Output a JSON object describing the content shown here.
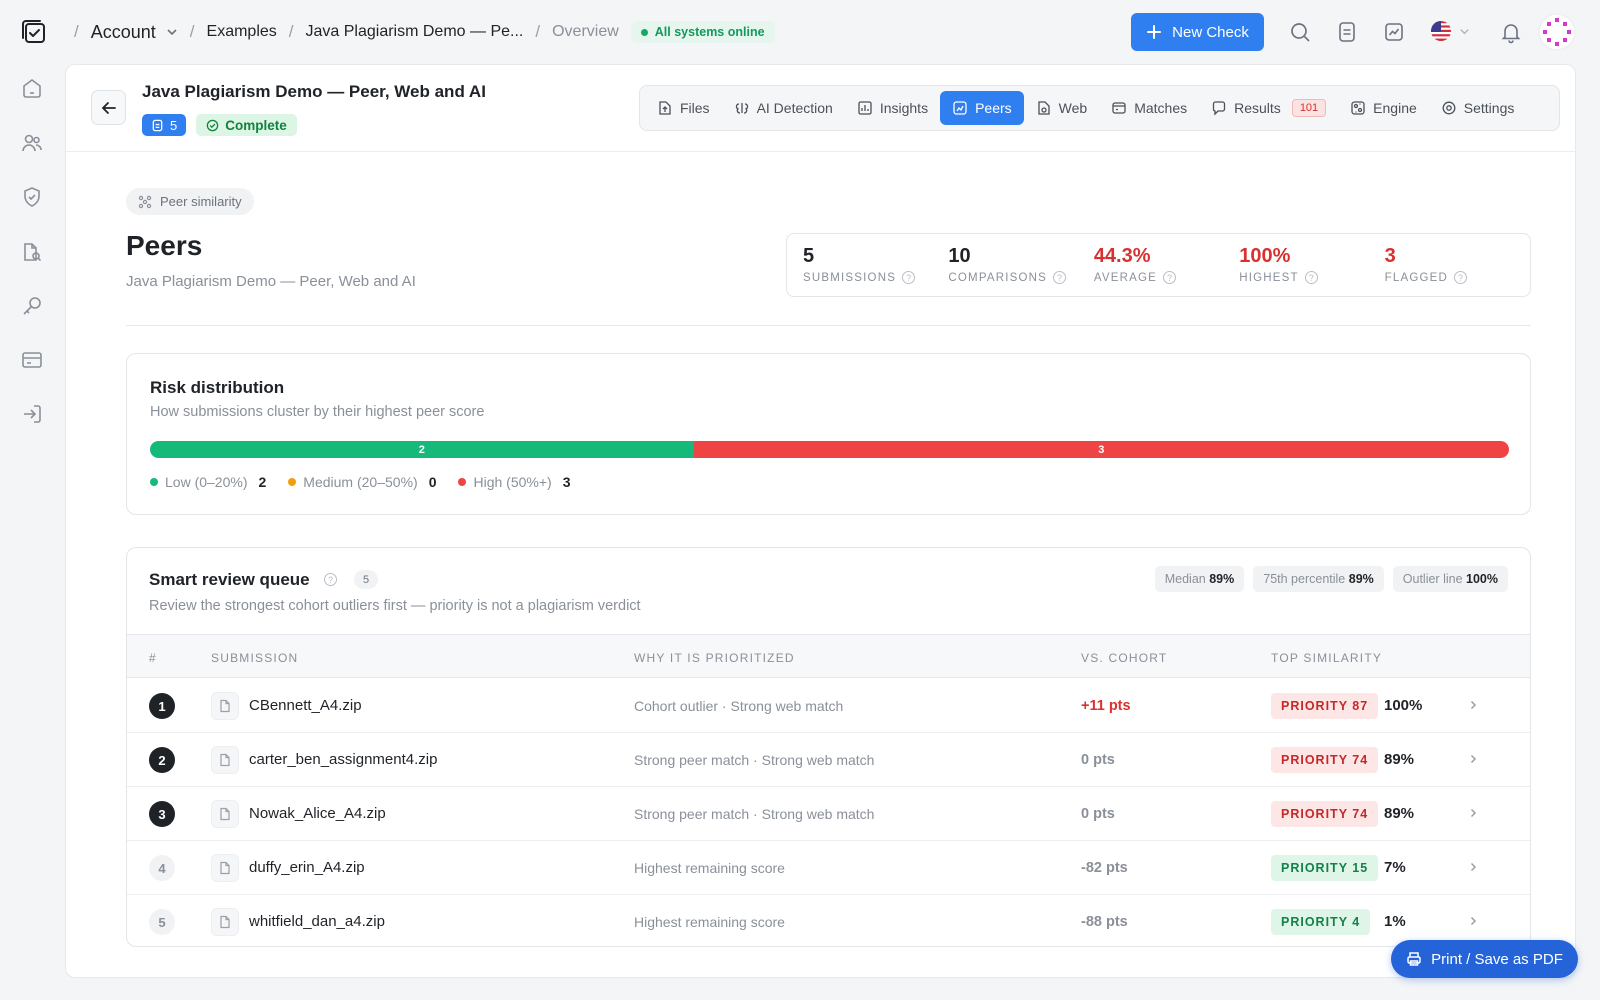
{
  "breadcrumbs": {
    "account": "Account",
    "examples": "Examples",
    "document": "Java Plagiarism Demo — Pe...",
    "current": "Overview"
  },
  "status": {
    "label": "All systems online",
    "color": "#18a864"
  },
  "header_actions": {
    "new_check": "New Check"
  },
  "document": {
    "title": "Java Plagiarism Demo — Peer, Web and AI",
    "file_count": "5",
    "status": "Complete"
  },
  "tabs": [
    {
      "label": "Files",
      "icon": "upload-doc-icon"
    },
    {
      "label": "AI Detection",
      "icon": "brain-icon"
    },
    {
      "label": "Insights",
      "icon": "insights-icon"
    },
    {
      "label": "Peers",
      "icon": "peers-icon",
      "active": true
    },
    {
      "label": "Web",
      "icon": "web-doc-icon"
    },
    {
      "label": "Matches",
      "icon": "matches-icon"
    },
    {
      "label": "Results",
      "icon": "results-icon",
      "count": "101"
    },
    {
      "label": "Engine",
      "icon": "engine-icon"
    },
    {
      "label": "Settings",
      "icon": "gear-icon"
    }
  ],
  "section": {
    "pill": "Peer similarity",
    "title": "Peers",
    "subtitle": "Java Plagiarism Demo — Peer, Web and AI"
  },
  "stats": [
    {
      "value": "5",
      "label": "SUBMISSIONS"
    },
    {
      "value": "10",
      "label": "COMPARISONS"
    },
    {
      "value": "44.3%",
      "label": "AVERAGE",
      "alert": true
    },
    {
      "value": "100%",
      "label": "HIGHEST",
      "alert": true
    },
    {
      "value": "3",
      "label": "FLAGGED",
      "alert": true
    }
  ],
  "risk": {
    "title": "Risk distribution",
    "subtitle": "How submissions cluster by their highest peer score",
    "segments": [
      {
        "label": "Low (0–20%)",
        "count": 2,
        "color": "#15b97a"
      },
      {
        "label": "Medium (20–50%)",
        "count": 0,
        "color": "#f59e0b"
      },
      {
        "label": "High (50%+)",
        "count": 3,
        "color": "#ef4444"
      }
    ]
  },
  "queue": {
    "title": "Smart review queue",
    "count": "5",
    "subtitle": "Review the strongest cohort outliers first — priority is not a plagiarism verdict",
    "chips": [
      {
        "label": "Median",
        "value": "89%"
      },
      {
        "label": "75th percentile",
        "value": "89%"
      },
      {
        "label": "Outlier line",
        "value": "100%"
      }
    ],
    "columns": [
      "#",
      "SUBMISSION",
      "WHY IT IS PRIORITIZED",
      "VS. COHORT",
      "TOP SIMILARITY"
    ],
    "rows": [
      {
        "rank": "1",
        "file": "CBennett_A4.zip",
        "why": "Cohort outlier · Strong web match",
        "vs": "+11 pts",
        "priority": "PRIORITY 87",
        "level": "high",
        "top": "100%"
      },
      {
        "rank": "2",
        "file": "carter_ben_assignment4.zip",
        "why": "Strong peer match · Strong web match",
        "vs": "0 pts",
        "priority": "PRIORITY 74",
        "level": "high",
        "top": "89%"
      },
      {
        "rank": "3",
        "file": "Nowak_Alice_A4.zip",
        "why": "Strong peer match · Strong web match",
        "vs": "0 pts",
        "priority": "PRIORITY 74",
        "level": "high",
        "top": "89%"
      },
      {
        "rank": "4",
        "file": "duffy_erin_A4.zip",
        "why": "Highest remaining score",
        "vs": "-82 pts",
        "priority": "PRIORITY 15",
        "level": "low",
        "top": "7%"
      },
      {
        "rank": "5",
        "file": "whitfield_dan_a4.zip",
        "why": "Highest remaining score",
        "vs": "-88 pts",
        "priority": "PRIORITY 4",
        "level": "low",
        "top": "1%"
      }
    ]
  },
  "print_button": "Print / Save as PDF"
}
